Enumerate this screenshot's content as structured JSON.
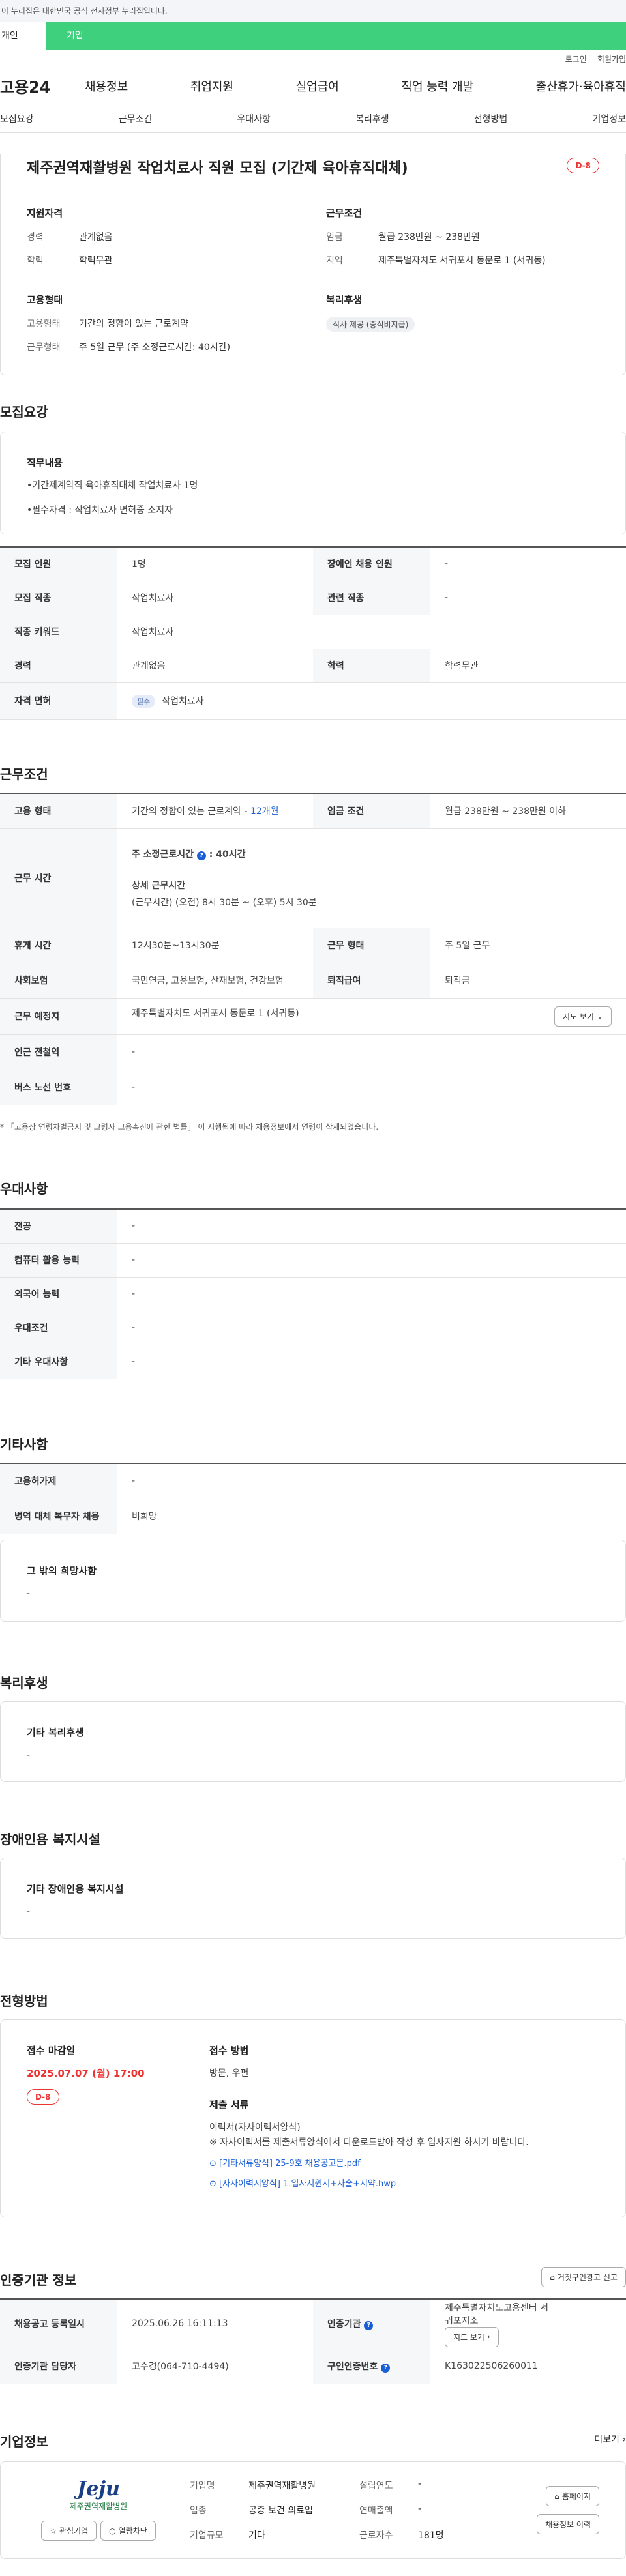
{
  "banner": {
    "text": "이 누리집은 대한민국 공식 전자정부 누리집입니다."
  },
  "type_tabs": [
    "개인",
    "기업"
  ],
  "util": [
    "로그인",
    "회원가입"
  ],
  "logo": "고용24",
  "gnb": [
    "채용정보",
    "취업지원",
    "실업급여",
    "직업 능력 개발",
    "출산휴가·육아휴직"
  ],
  "anchors": [
    "모집요강",
    "근무조건",
    "우대사항",
    "복리후생",
    "전형방법",
    "기업정보"
  ],
  "summary": {
    "title": "제주권역재활병원 작업치료사 직원 모집 (기간제 육아휴직대체)",
    "dday": "D-8",
    "qual": {
      "heading": "지원자격",
      "rows": [
        {
          "k": "경력",
          "v": "관계없음"
        },
        {
          "k": "학력",
          "v": "학력무관"
        }
      ]
    },
    "cond": {
      "heading": "근무조건",
      "rows": [
        {
          "k": "임금",
          "v": "월급 238만원 ~ 238만원"
        },
        {
          "k": "지역",
          "v": "제주특별자치도 서귀포시 동문로 1 (서귀동)"
        }
      ]
    },
    "emp": {
      "heading": "고용형태",
      "rows": [
        {
          "k": "고용형태",
          "v": "기간의 정함이 있는 근로계약"
        },
        {
          "k": "근무형태",
          "v": "주 5일 근무 (주 소정근로시간: 40시간)"
        }
      ]
    },
    "welfare": {
      "heading": "복리후생",
      "chip": "식사 제공 (중식비지급)"
    }
  },
  "recruit": {
    "title": "모집요강",
    "duty_heading": "직무내용",
    "duty_lines": [
      "•기간제계약직 육아휴직대체 작업치료사 1명",
      "•필수자격 : 작업치료사 면허증 소지자"
    ],
    "rows": [
      {
        "k1": "모집 인원",
        "v1": "1명",
        "k2": "장애인 채용 인원",
        "v2": "-"
      },
      {
        "k1": "모집 직종",
        "v1": "작업치료사",
        "k2": "관련 직종",
        "v2": "-"
      },
      {
        "k1": "직종 키워드",
        "v1": "작업치료사"
      },
      {
        "k1": "경력",
        "v1": "관계없음",
        "k2": "학력",
        "v2": "학력무관"
      },
      {
        "k1": "자격 면허",
        "badge": "필수",
        "v1": "작업치료사"
      }
    ]
  },
  "work": {
    "title": "근무조건",
    "type_k": "고용 형태",
    "type_v": "기간의 정함이 있는 근로계약 - ",
    "type_months": "12개월",
    "wage_k": "임금 조건",
    "wage_v": "월급 238만원 ~ 238만원 이하",
    "hours_k": "근무 시간",
    "hours_weekly": "주 소정근로시간",
    "hours_weekly_v": ": 40시간",
    "hours_detail_h": "상세 근무시간",
    "hours_detail": "(근무시간) (오전) 8시 30분 ~ (오후) 5시 30분",
    "rest_k": "휴게 시간",
    "rest_v": "12시30분~13시30분",
    "form_k": "근무 형태",
    "form_v": "주 5일 근무",
    "ins_k": "사회보험",
    "ins_v": "국민연금, 고용보험, 산재보험, 건강보험",
    "ret_k": "퇴직급여",
    "ret_v": "퇴직금",
    "loc_k": "근무 예정지",
    "loc_v": "제주특별자치도 서귀포시 동문로 1 (서귀동)",
    "map_btn": "지도 보기",
    "station_k": "인근 전철역",
    "station_v": "-",
    "bus_k": "버스 노선 번호",
    "bus_v": "-",
    "note": "* 「고용상 연령차별금지 및 고령자 고용촉진에 관한 법률」 이 시행됨에 따라 채용정보에서 연령이 삭제되었습니다."
  },
  "pref": {
    "title": "우대사항",
    "rows": [
      {
        "k": "전공",
        "v": "-"
      },
      {
        "k": "컴퓨터 활용 능력",
        "v": "-"
      },
      {
        "k": "외국어 능력",
        "v": "-"
      },
      {
        "k": "우대조건",
        "v": "-"
      },
      {
        "k": "기타 우대사항",
        "v": "-"
      }
    ]
  },
  "etc": {
    "title": "기타사항",
    "rows": [
      {
        "k": "고용허가제",
        "v": "-"
      },
      {
        "k": "병역 대체 복무자 채용",
        "v": "비희망"
      }
    ],
    "box_h": "그 밖의 희망사항",
    "box_v": "-"
  },
  "welfare": {
    "title": "복리후생",
    "box_h": "기타 복리후생",
    "box_v": "-"
  },
  "disab": {
    "title": "장애인용 복지시설",
    "box_h": "기타 장애인용 복지시설",
    "box_v": "-"
  },
  "selection": {
    "title": "전형방법",
    "deadline_h": "접수 마감일",
    "deadline": "2025.07.07 (월) 17:00",
    "dday": "D-8",
    "method_h": "접수 방법",
    "method_v": "방문, 우편",
    "docs_h": "제출 서류",
    "docs_lines": [
      "이력서(자사이력서양식)",
      "※ 자사이력서를 제출서류양식에서 다운로드받아 작성 후 입사지원 하시기 바랍니다."
    ],
    "files": [
      "[기타서류양식] 25-9호 채용공고문.pdf",
      "[자사이력서양식] 1.입사지원서+자술+서약.hwp"
    ]
  },
  "cert": {
    "title": "인증기관 정보",
    "report_btn": "거짓구인광고 신고",
    "row1": {
      "k1": "채용공고 등록일시",
      "v1": "2025.06.26 16:11:13",
      "k2": "인증기관",
      "v2": "제주특별자치도고용센터 서귀포지소",
      "btn": "지도 보기"
    },
    "row2": {
      "k1": "인증기관 담당자",
      "v1": "고수경(064-710-4494)",
      "k2": "구인인증번호",
      "v2": "K163022506260011"
    }
  },
  "company": {
    "title": "기업정보",
    "more": "더보기",
    "logo_text": "Jeju",
    "logo_sub": "제주권역재활병원",
    "fav": "관심기업",
    "block": "열람차단",
    "fields": [
      {
        "k": "기업명",
        "v": "제주권역재활병원"
      },
      {
        "k": "설립연도",
        "v": "-"
      },
      {
        "k": "업종",
        "v": "공중 보건 의료업"
      },
      {
        "k": "연매출액",
        "v": "-"
      },
      {
        "k": "기업규모",
        "v": "기타"
      },
      {
        "k": "근로자수",
        "v": "181명"
      }
    ],
    "btn_home": "홈페이지",
    "btn_hist": "채용정보 이력"
  },
  "colors": {
    "accent_green": "#3ed07c",
    "dday_red": "#e33333",
    "link_blue": "#1a5fd6"
  }
}
